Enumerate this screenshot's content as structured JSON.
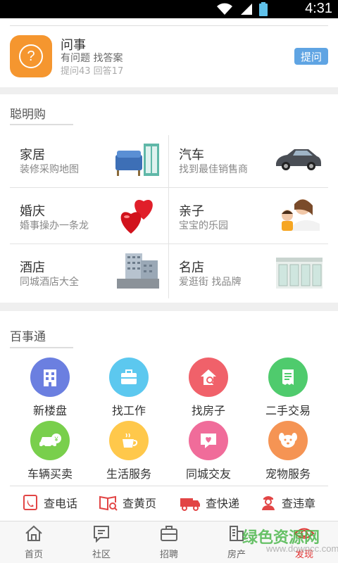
{
  "statusbar": {
    "time": "4:31"
  },
  "ask": {
    "title": "问事",
    "subtitle": "有问题 找答案",
    "stats": "提问43 回答17",
    "button": "提问",
    "icon": "question-icon"
  },
  "smart": {
    "section_title": "聪明购",
    "cells": [
      {
        "title": "家居",
        "subtitle": "装修采购地图",
        "icon": "sofa-image"
      },
      {
        "title": "汽车",
        "subtitle": "找到最佳销售商",
        "icon": "car-image"
      },
      {
        "title": "婚庆",
        "subtitle": "婚事操办一条龙",
        "icon": "hearts-image"
      },
      {
        "title": "亲子",
        "subtitle": "宝宝的乐园",
        "icon": "family-image"
      },
      {
        "title": "酒店",
        "subtitle": "同城酒店大全",
        "icon": "hotel-image"
      },
      {
        "title": "名店",
        "subtitle": "爱逛街 找品牌",
        "icon": "storefront-image"
      }
    ]
  },
  "services": {
    "section_title": "百事通",
    "items": [
      {
        "label": "新楼盘",
        "icon": "building-icon",
        "color": "#6b7fe0"
      },
      {
        "label": "找工作",
        "icon": "briefcase-icon",
        "color": "#5cc8ef"
      },
      {
        "label": "找房子",
        "icon": "house-search-icon",
        "color": "#f0616a"
      },
      {
        "label": "二手交易",
        "icon": "receipt-icon",
        "color": "#4fcb6d"
      },
      {
        "label": "车辆买卖",
        "icon": "car-yen-icon",
        "color": "#79cf4c"
      },
      {
        "label": "生活服务",
        "icon": "cup-icon",
        "color": "#ffc84b"
      },
      {
        "label": "同城交友",
        "icon": "heart-chat-icon",
        "color": "#f06c9a"
      },
      {
        "label": "宠物服务",
        "icon": "dog-icon",
        "color": "#f59454"
      }
    ],
    "quick": [
      {
        "label": "查电话",
        "icon": "phone-book-icon"
      },
      {
        "label": "查黄页",
        "icon": "yellow-pages-icon"
      },
      {
        "label": "查快递",
        "icon": "delivery-truck-icon"
      },
      {
        "label": "查违章",
        "icon": "traffic-officer-icon"
      }
    ]
  },
  "nav": {
    "items": [
      {
        "label": "首页",
        "icon": "home-icon"
      },
      {
        "label": "社区",
        "icon": "chat-icon"
      },
      {
        "label": "招聘",
        "icon": "briefcase-icon"
      },
      {
        "label": "房产",
        "icon": "building-icon"
      },
      {
        "label": "发现",
        "icon": "eye-icon"
      }
    ],
    "active_color": "#e23030"
  },
  "watermark": {
    "big": "绿色资源网",
    "small": "www.downcc.com"
  }
}
